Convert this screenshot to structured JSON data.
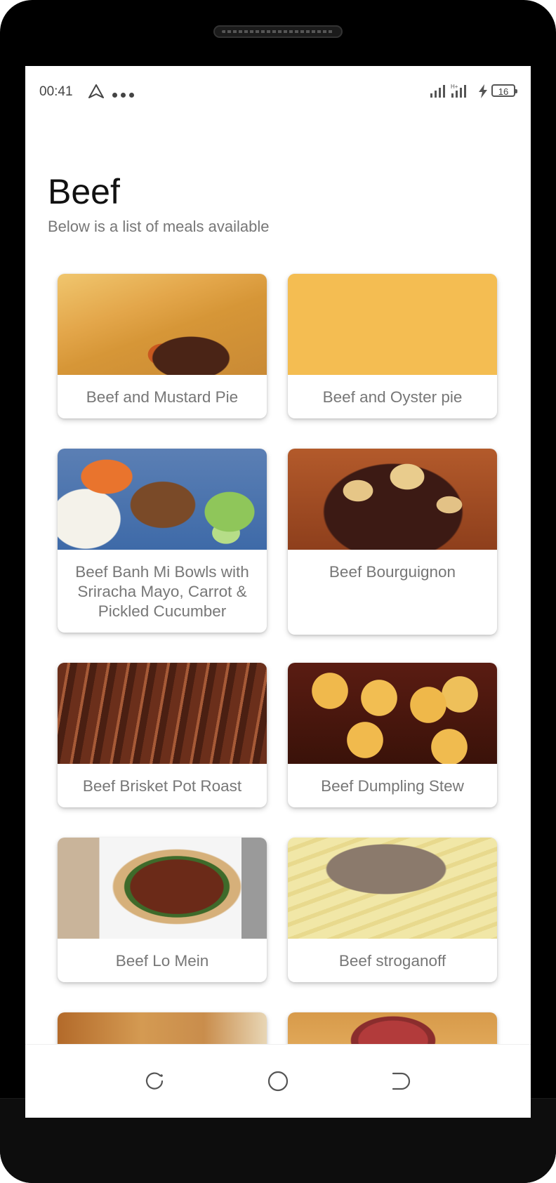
{
  "status_bar": {
    "time": "00:41",
    "battery": "16",
    "icons": [
      "navigation-arrow-icon",
      "more-dots-icon",
      "signal-icon",
      "signal-icon",
      "charging-icon",
      "battery-icon"
    ]
  },
  "page": {
    "title": "Beef",
    "subtitle": "Below is a list of meals available"
  },
  "meals": [
    {
      "name": "Beef and Mustard Pie"
    },
    {
      "name": "Beef and Oyster pie"
    },
    {
      "name": "Beef Banh Mi Bowls with Sriracha Mayo, Carrot & Pickled Cucumber"
    },
    {
      "name": "Beef Bourguignon"
    },
    {
      "name": "Beef Brisket Pot Roast"
    },
    {
      "name": "Beef Dumpling Stew"
    },
    {
      "name": "Beef Lo Mein"
    },
    {
      "name": "Beef stroganoff"
    }
  ],
  "nav_bar": {
    "buttons": [
      "recent-apps-icon",
      "home-icon",
      "back-icon"
    ]
  }
}
